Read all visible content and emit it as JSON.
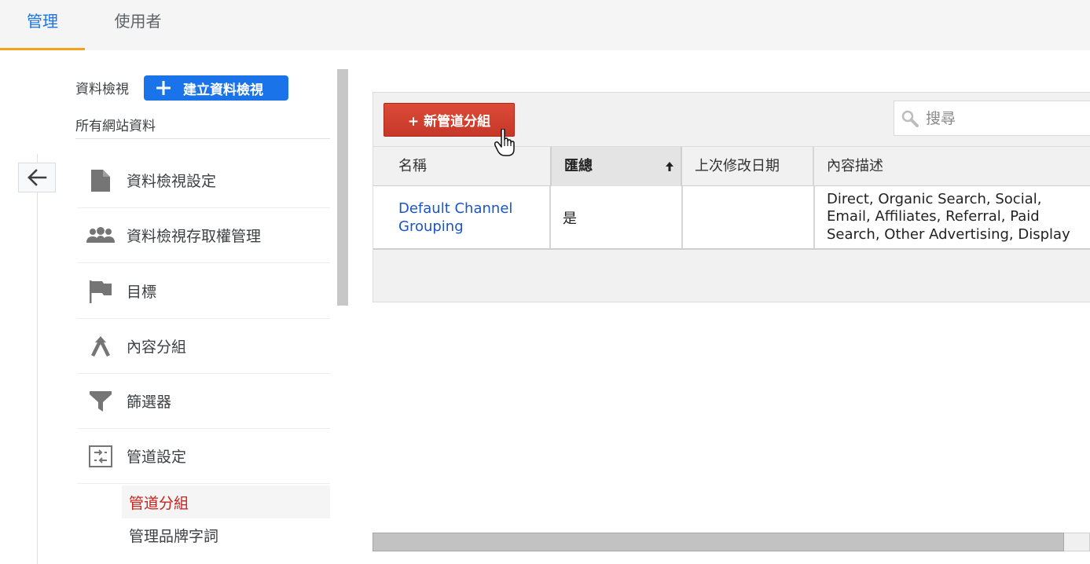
{
  "tabs": {
    "admin": "管理",
    "user": "使用者"
  },
  "view": {
    "label": "資料檢視",
    "create_button": "建立資料檢視",
    "current_view": "所有網站資料"
  },
  "nav": {
    "items": [
      {
        "label": "資料檢視設定",
        "icon": "document-icon"
      },
      {
        "label": "資料檢視存取權管理",
        "icon": "people-icon"
      },
      {
        "label": "目標",
        "icon": "flag-icon"
      },
      {
        "label": "內容分組",
        "icon": "merge-icon"
      },
      {
        "label": "篩選器",
        "icon": "filter-icon"
      },
      {
        "label": "管道設定",
        "icon": "channel-settings-icon"
      }
    ],
    "sub_items": [
      {
        "label": "管道分組",
        "active": true
      },
      {
        "label": "管理品牌字詞",
        "active": false
      }
    ]
  },
  "toolbar": {
    "new_button": "+ 新管道分組",
    "search_placeholder": "搜尋"
  },
  "table": {
    "columns": [
      "名稱",
      "匯總",
      "上次修改日期",
      "內容描述"
    ],
    "sorted_column": "匯總",
    "rows": [
      {
        "name": "Default Channel Grouping",
        "aggregate": "是",
        "last_modified": "",
        "description": "Direct, Organic Search, Social, Email, Affiliates, Referral, Paid Search, Other Advertising, Display"
      }
    ]
  },
  "colors": {
    "accent": "#1a73e8",
    "tab_underline": "#f4a218",
    "new_button": "#d14836",
    "active_sub_item": "#c5221f",
    "link": "#1a55c4"
  }
}
